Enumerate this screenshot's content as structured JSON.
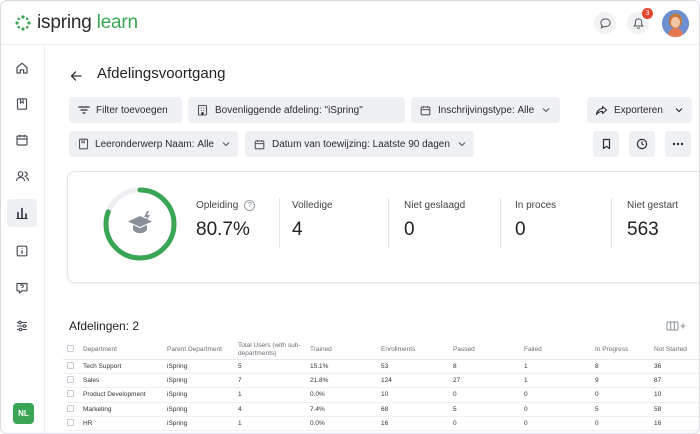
{
  "app": {
    "logo_part1": "ispring",
    "logo_part2": "learn",
    "brand_color": "#3aa655",
    "notification_count": "3"
  },
  "sidebar": {
    "items": [
      {
        "icon": "home-icon"
      },
      {
        "icon": "book-icon"
      },
      {
        "icon": "calendar-icon"
      },
      {
        "icon": "users-icon"
      },
      {
        "icon": "reports-icon",
        "active": true
      },
      {
        "icon": "info-icon"
      },
      {
        "icon": "help-icon"
      },
      {
        "icon": "settings-sliders-icon"
      }
    ],
    "user_initials": "NL"
  },
  "page": {
    "title": "Afdelingsvoortgang"
  },
  "filters": {
    "add_filter": "Filter toevoegen",
    "parent_dept_label": "Bovenliggende afdeling: \"iSpring\"",
    "enrollment_label": "Inschrijvingstype:",
    "enrollment_value": "Alle",
    "export": "Exporteren",
    "subject_label": "Leeronderwerp Naam:",
    "subject_value": "Alle",
    "assign_date_label": "Datum van toewijzing:",
    "assign_date_value": "Laatste 90 dagen"
  },
  "stats": {
    "progress_fraction": 0.807,
    "training_label": "Opleiding",
    "training_value": "80.7%",
    "complete_label": "Volledige",
    "complete_value": "4",
    "failed_label": "Niet geslaagd",
    "failed_value": "0",
    "in_progress_label": "In proces",
    "in_progress_value": "0",
    "not_started_label": "Niet gestart",
    "not_started_value": "563"
  },
  "departments": {
    "title": "Afdelingen: 2",
    "columns": [
      "Department",
      "Parent Department",
      "Total Users (with sub-departments)",
      "Trained",
      "Enrollments",
      "Passed",
      "Failed",
      "In Progress",
      "Not Started"
    ],
    "rows": [
      [
        "Tech Support",
        "iSpring",
        "5",
        "15.1%",
        "53",
        "8",
        "1",
        "8",
        "36"
      ],
      [
        "Sales",
        "iSpring",
        "7",
        "21.8%",
        "124",
        "27",
        "1",
        "9",
        "87"
      ],
      [
        "Product Development",
        "iSpring",
        "1",
        "0.0%",
        "10",
        "0",
        "0",
        "0",
        "10"
      ],
      [
        "Marketing",
        "iSpring",
        "4",
        "7.4%",
        "68",
        "5",
        "0",
        "5",
        "58"
      ],
      [
        "HR",
        "iSpring",
        "1",
        "0.0%",
        "16",
        "0",
        "0",
        "0",
        "16"
      ]
    ]
  }
}
